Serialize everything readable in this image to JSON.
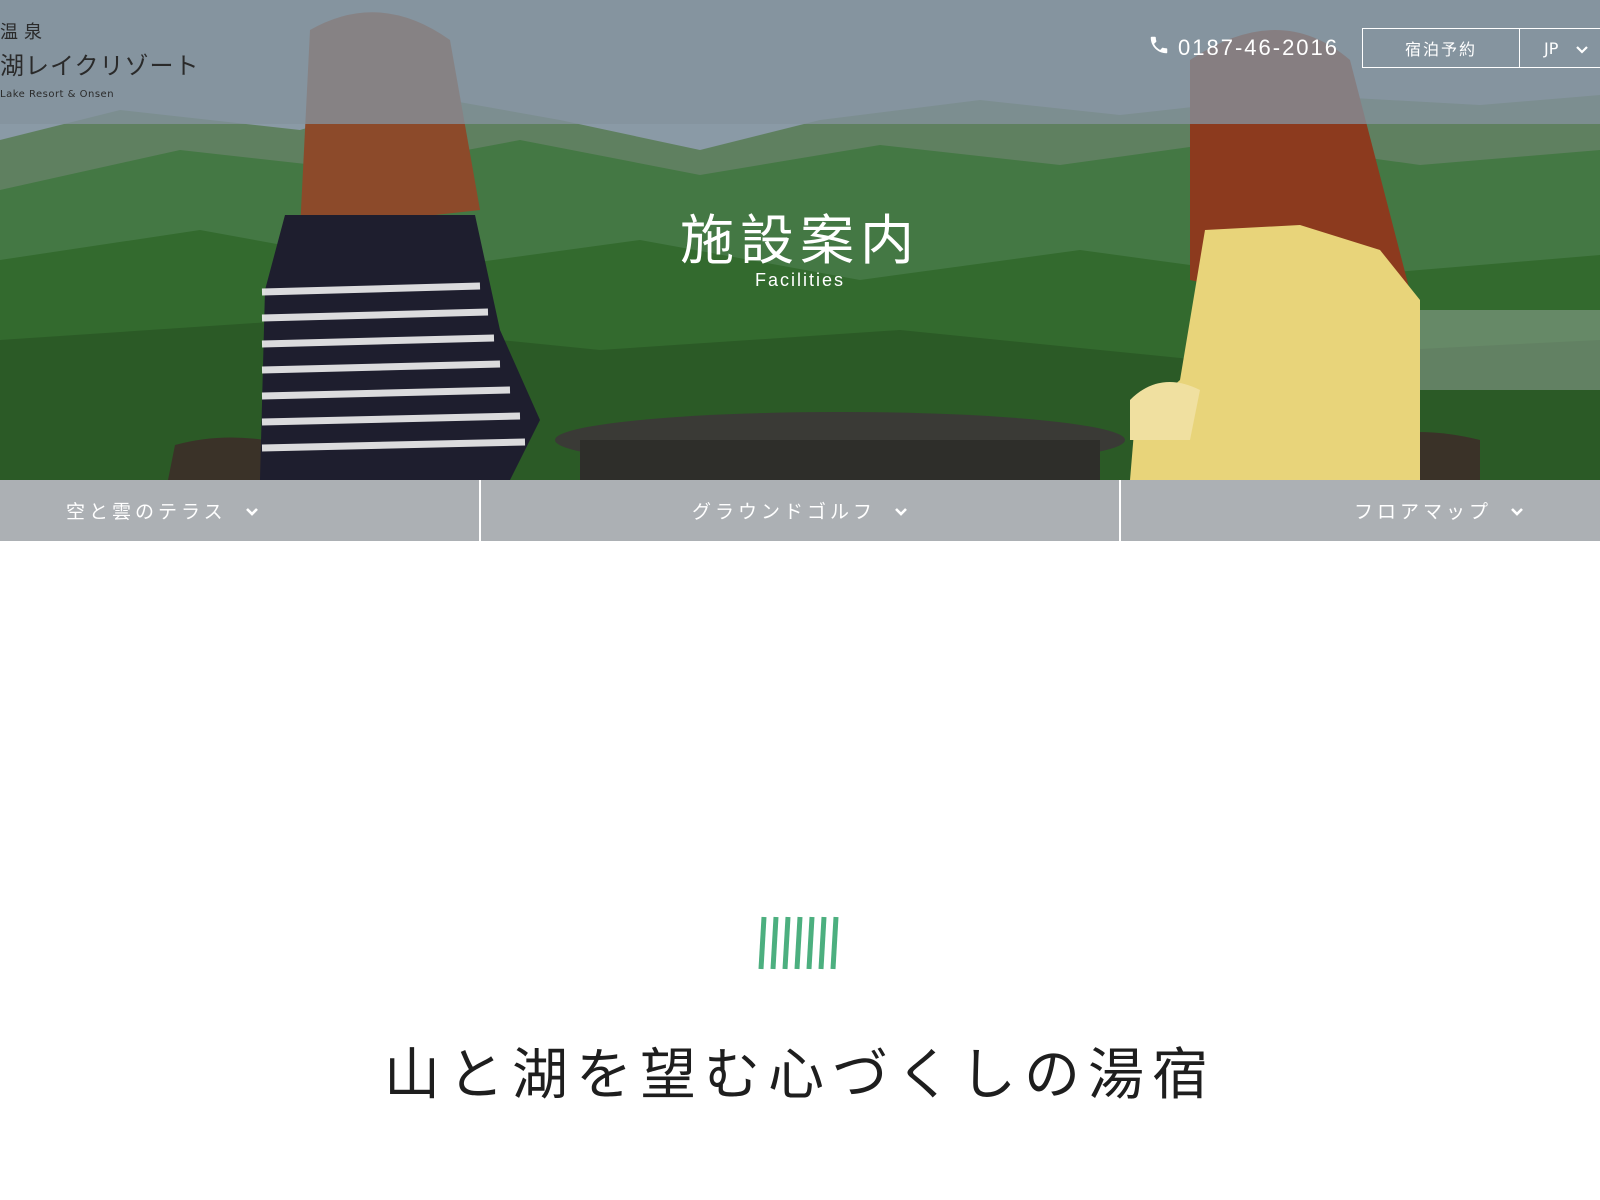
{
  "header": {
    "logo_line1": "温泉",
    "logo_line2": "湖レイクリゾート",
    "logo_line3": "Lake Resort & Onsen",
    "phone": "0187-46-2016",
    "reserve_label": "宿泊予約",
    "language": "JP"
  },
  "hero": {
    "title": "施設案内",
    "subtitle": "Facilities"
  },
  "subnav": {
    "items": [
      {
        "label": "空と雲のテラス"
      },
      {
        "label": "グラウンドゴルフ"
      },
      {
        "label": "フロアマップ"
      }
    ]
  },
  "main": {
    "heading": "山と湖を望む心づくしの湯宿",
    "accent_color": "#4caf7f"
  },
  "icons": [
    "phone-icon",
    "chevron-down-icon",
    "stripes-ornament-icon"
  ]
}
